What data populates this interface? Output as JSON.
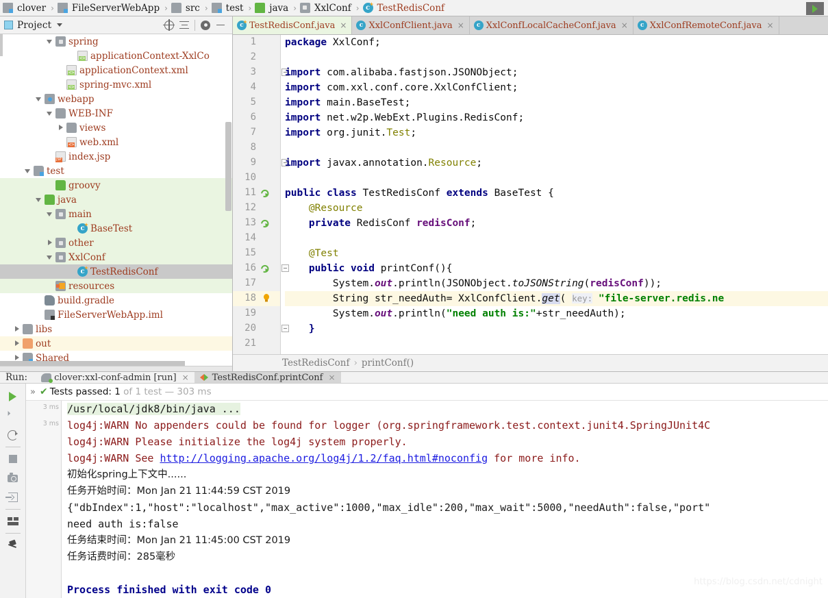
{
  "breadcrumb": {
    "items": [
      {
        "label": "clover",
        "icon": "module-icon",
        "style": "dark"
      },
      {
        "label": "FileServerWebApp",
        "icon": "module-icon",
        "style": "dark"
      },
      {
        "label": "src",
        "icon": "folder-gray-icon",
        "style": "dark"
      },
      {
        "label": "test",
        "icon": "module-icon",
        "style": "dark"
      },
      {
        "label": "java",
        "icon": "folder-green-icon",
        "style": "dark"
      },
      {
        "label": "XxlConf",
        "icon": "package-icon",
        "style": "dark"
      },
      {
        "label": "TestRedisConf",
        "icon": "java-class-icon",
        "style": "red"
      }
    ],
    "separator": "›",
    "run_icon": "run-configuration-icon"
  },
  "project_panel": {
    "title": "Project",
    "dropdown_icon": "chevron-down-icon",
    "buttons": [
      {
        "name": "locate-icon"
      },
      {
        "name": "collapse-all-icon"
      },
      {
        "name": "gear-icon"
      },
      {
        "name": "hide-icon"
      }
    ],
    "tree": [
      {
        "label": "spring",
        "indent": 5,
        "arrow": "down",
        "icon": "package-icon",
        "row": "plain"
      },
      {
        "label": "applicationContext-XxlCo",
        "indent": 7,
        "arrow": "none",
        "icon": "xml-file-icon",
        "row": "plain"
      },
      {
        "label": "applicationContext.xml",
        "indent": 6,
        "arrow": "none",
        "icon": "xml-file-icon",
        "row": "plain"
      },
      {
        "label": "spring-mvc.xml",
        "indent": 6,
        "arrow": "none",
        "icon": "xml-file-icon",
        "row": "plain"
      },
      {
        "label": "webapp",
        "indent": 4,
        "arrow": "down",
        "icon": "webapp-folder-icon",
        "row": "plain"
      },
      {
        "label": "WEB-INF",
        "indent": 5,
        "arrow": "down",
        "icon": "folder-gray-icon",
        "row": "plain"
      },
      {
        "label": "views",
        "indent": 6,
        "arrow": "right",
        "icon": "folder-gray-icon",
        "row": "plain"
      },
      {
        "label": "web.xml",
        "indent": 6,
        "arrow": "none",
        "icon": "xml-orange-icon",
        "row": "plain"
      },
      {
        "label": "index.jsp",
        "indent": 5,
        "arrow": "none",
        "icon": "jsp-file-icon",
        "row": "plain"
      },
      {
        "label": "test",
        "indent": 3,
        "arrow": "down",
        "icon": "module-folder-icon",
        "row": "plain"
      },
      {
        "label": "groovy",
        "indent": 5,
        "arrow": "none",
        "icon": "folder-green-icon",
        "row": "green"
      },
      {
        "label": "java",
        "indent": 4,
        "arrow": "down",
        "icon": "folder-green-icon",
        "row": "green"
      },
      {
        "label": "main",
        "indent": 5,
        "arrow": "down",
        "icon": "package-icon",
        "row": "green"
      },
      {
        "label": "BaseTest",
        "indent": 7,
        "arrow": "none",
        "icon": "java-class-icon",
        "row": "green"
      },
      {
        "label": "other",
        "indent": 5,
        "arrow": "right",
        "icon": "package-icon",
        "row": "green"
      },
      {
        "label": "XxlConf",
        "indent": 5,
        "arrow": "down",
        "icon": "package-icon",
        "row": "green"
      },
      {
        "label": "TestRedisConf",
        "indent": 7,
        "arrow": "none",
        "icon": "java-class-icon",
        "row": "selected"
      },
      {
        "label": "resources",
        "indent": 5,
        "arrow": "none",
        "icon": "resources-folder-icon",
        "row": "green"
      },
      {
        "label": "build.gradle",
        "indent": 4,
        "arrow": "none",
        "icon": "gradle-file-icon",
        "row": "plain"
      },
      {
        "label": "FileServerWebApp.iml",
        "indent": 4,
        "arrow": "none",
        "icon": "iml-file-icon",
        "row": "plain"
      },
      {
        "label": "libs",
        "indent": 2,
        "arrow": "right",
        "icon": "folder-gray-icon",
        "row": "plain"
      },
      {
        "label": "out",
        "indent": 2,
        "arrow": "right",
        "icon": "folder-orange-icon",
        "row": "yellow"
      },
      {
        "label": "Shared",
        "indent": 2,
        "arrow": "right",
        "icon": "module-folder-icon",
        "row": "plain"
      }
    ]
  },
  "editor": {
    "tabs": [
      {
        "label": "TestRedisConf.java",
        "active": true,
        "close": "×"
      },
      {
        "label": "XxlConfClient.java",
        "active": false,
        "close": "×"
      },
      {
        "label": "XxlConfLocalCacheConf.java",
        "active": false,
        "close": "×"
      },
      {
        "label": "XxlConfRemoteConf.java",
        "active": false,
        "close": "×"
      }
    ],
    "line_numbers": [
      "1",
      "2",
      "3",
      "4",
      "5",
      "6",
      "7",
      "8",
      "9",
      "10",
      "11",
      "12",
      "13",
      "14",
      "15",
      "16",
      "17",
      "18",
      "19",
      "20",
      "21"
    ],
    "highlighted_line": "18",
    "gutter_icons": [
      {
        "line": "11",
        "name": "run-class-icon"
      },
      {
        "line": "13",
        "name": "bean-navigate-icon"
      },
      {
        "line": "16",
        "name": "run-method-icon"
      },
      {
        "line": "18",
        "name": "intention-bulb-icon"
      }
    ],
    "breadcrumb": {
      "class": "TestRedisConf",
      "separator": "›",
      "method": "printConf()"
    },
    "code": {
      "l1_kw": "package",
      "l1_rest": " XxlConf;",
      "l3_kw": "import",
      "l3_rest": " com.alibaba.fastjson.JSONObject;",
      "l4_kw": "import",
      "l4_rest": " com.xxl.conf.core.XxlConfClient;",
      "l5_kw": "import",
      "l5_rest": " main.BaseTest;",
      "l6_kw": "import",
      "l6_rest": " net.w2p.WebExt.Plugins.RedisConf;",
      "l7_kw": "import",
      "l7_a": " org.junit.",
      "l7_type": "Test",
      "l7_end": ";",
      "l9_kw": "import",
      "l9_a": " javax.annotation.",
      "l9_type": "Resource",
      "l9_end": ";",
      "l11_kw1": "public",
      "l11_kw2": "class",
      "l11_name": " TestRedisConf ",
      "l11_kw3": "extends",
      "l11_tail": " BaseTest {",
      "l12_ann": "@Resource",
      "l13_kw": "private",
      "l13_type": " RedisConf ",
      "l13_field": "redisConf",
      "l13_end": ";",
      "l15_ann": "@Test",
      "l16_kw1": "public",
      "l16_kw2": "void",
      "l16_tail": " printConf(){",
      "l17_a": "System.",
      "l17_out": "out",
      "l17_b": ".println(JSONObject.",
      "l17_mth": "toJSONString",
      "l17_c": "(",
      "l17_fld": "redisConf",
      "l17_d": "));",
      "l18_a": "String str_needAuth= XxlConfClient.",
      "l18_get": "get",
      "l18_b": "( ",
      "l18_hint": "key:",
      "l18_str": " \"file-server.redis.ne",
      "l19_a": "System.",
      "l19_out": "out",
      "l19_b": ".println(",
      "l19_str": "\"need auth is:\"",
      "l19_c": "+str_needAuth);",
      "l20": "}"
    }
  },
  "run_panel": {
    "label": "Run:",
    "tabs": [
      {
        "label": "clover:xxl-conf-admin [run]",
        "icon": "gradle-elephant-icon",
        "active": false,
        "close": "×"
      },
      {
        "label": "TestRedisConf.printConf",
        "icon": "junit-icon",
        "active": true,
        "close": "×"
      }
    ],
    "toolbar": [
      {
        "name": "rerun-icon"
      },
      {
        "name": "rerun-failed-icon"
      },
      {
        "name": "toggle-auto-test-icon"
      },
      {
        "name": "stop-icon"
      },
      {
        "name": "export-snapshot-icon"
      },
      {
        "name": "import-tests-icon"
      },
      {
        "name": "soft-wrap-icon"
      },
      {
        "name": "pin-tab-icon"
      }
    ],
    "status": {
      "expand_icon": "»",
      "check_icon": "✔",
      "passed_label": "Tests passed:",
      "count": "1",
      "of_label": "of",
      "total": "1",
      "test_word": "test",
      "dash": "—",
      "duration": "303 ms"
    },
    "timestamps": [
      "3 ms",
      "3 ms"
    ],
    "console": [
      {
        "type": "cmd",
        "text": "/usr/local/jdk8/bin/java ..."
      },
      {
        "type": "warn",
        "text": "log4j:WARN No appenders could be found for logger (org.springframework.test.context.junit4.SpringJUnit4C"
      },
      {
        "type": "warn",
        "text": "log4j:WARN Please initialize the log4j system properly."
      },
      {
        "type": "warnlink",
        "pre": "log4j:WARN See ",
        "link": "http://logging.apache.org/log4j/1.2/faq.html#noconfig",
        "post": " for more info."
      },
      {
        "type": "black",
        "text": "初始化spring上下文中......"
      },
      {
        "type": "black",
        "text": "任务开始时间：Mon Jan 21 11:44:59 CST 2019"
      },
      {
        "type": "black",
        "text": "{\"dbIndex\":1,\"host\":\"localhost\",\"max_active\":1000,\"max_idle\":200,\"max_wait\":5000,\"needAuth\":false,\"port\""
      },
      {
        "type": "black",
        "text": "need auth is:false"
      },
      {
        "type": "black",
        "text": "任务结束时间：Mon Jan 21 11:45:00 CST 2019"
      },
      {
        "type": "black",
        "text": "任务话费时间：285毫秒"
      },
      {
        "type": "blank",
        "text": ""
      },
      {
        "type": "blue",
        "text": "Process finished with exit code 0"
      }
    ]
  },
  "watermark": "https://blog.csdn.net/cdnight"
}
